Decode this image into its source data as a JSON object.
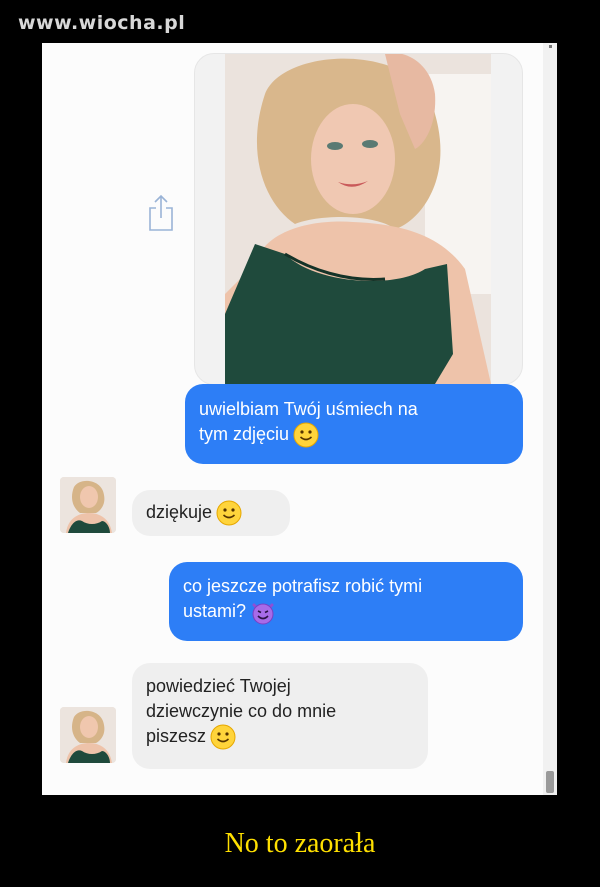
{
  "watermark": "www.wiocha.pl",
  "caption": "No to zaorała",
  "messages": [
    {
      "from": "me",
      "text_line1": "uwielbiam Twój uśmiech na",
      "text_line2": "tym zdjęciu",
      "emoji": "smile-emoji"
    },
    {
      "from": "her",
      "text_line1": "dziękuje",
      "emoji": "smile-emoji"
    },
    {
      "from": "me",
      "text_line1": "co jeszcze potrafisz robić tymi",
      "text_line2": "ustami?",
      "emoji": "devil-emoji"
    },
    {
      "from": "her",
      "text_line1": "powiedzieć Twojej",
      "text_line2": "dziewczynie co do mnie",
      "text_line3": "piszesz",
      "emoji": "smile-emoji"
    }
  ],
  "icons": {
    "share": "share-icon",
    "avatar": "avatar"
  },
  "colors": {
    "outgoing": "#2d7ef6",
    "incoming": "#efefef",
    "caption": "#ffe000"
  }
}
